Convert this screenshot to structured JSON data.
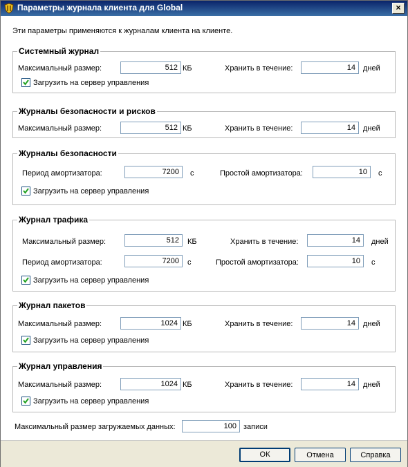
{
  "window": {
    "title": "Параметры журнала клиента для Global",
    "close_glyph": "×"
  },
  "intro_text": "Эти параметры применяются к журналам клиента на клиенте.",
  "groups": {
    "system": {
      "title": "Системный журнал",
      "max_size_label": "Максимальный размер:",
      "max_size_value": "512",
      "max_size_unit": "КБ",
      "keep_label": "Хранить в течение:",
      "keep_value": "14",
      "keep_unit": "дней",
      "upload_label": "Загрузить на сервер управления",
      "upload_checked": true
    },
    "security_risk": {
      "title": "Журналы безопасности и рисков",
      "max_size_label": "Максимальный размер:",
      "max_size_value": "512",
      "max_size_unit": "КБ",
      "keep_label": "Хранить в течение:",
      "keep_value": "14",
      "keep_unit": "дней"
    },
    "security": {
      "title": "Журналы безопасности",
      "damper_period_label": "Период амортизатора:",
      "damper_period_value": "7200",
      "damper_period_unit": "с",
      "damper_idle_label": "Простой амортизатора:",
      "damper_idle_value": "10",
      "damper_idle_unit": "с",
      "upload_label": "Загрузить на сервер управления",
      "upload_checked": true
    },
    "traffic": {
      "title": "Журнал трафика",
      "max_size_label": "Максимальный размер:",
      "max_size_value": "512",
      "max_size_unit": "КБ",
      "keep_label": "Хранить в течение:",
      "keep_value": "14",
      "keep_unit": "дней",
      "damper_period_label": "Период амортизатора:",
      "damper_period_value": "7200",
      "damper_period_unit": "с",
      "damper_idle_label": "Простой амортизатора:",
      "damper_idle_value": "10",
      "damper_idle_unit": "с",
      "upload_label": "Загрузить на сервер управления",
      "upload_checked": true
    },
    "packet": {
      "title": "Журнал пакетов",
      "max_size_label": "Максимальный размер:",
      "max_size_value": "1024",
      "max_size_unit": "КБ",
      "keep_label": "Хранить в течение:",
      "keep_value": "14",
      "keep_unit": "дней",
      "upload_label": "Загрузить на сервер управления",
      "upload_checked": true
    },
    "control": {
      "title": "Журнал управления",
      "max_size_label": "Максимальный размер:",
      "max_size_value": "1024",
      "max_size_unit": "КБ",
      "keep_label": "Хранить в течение:",
      "keep_value": "14",
      "keep_unit": "дней",
      "upload_label": "Загрузить на сервер управления",
      "upload_checked": true
    }
  },
  "upload_limit": {
    "label": "Максимальный размер загружаемых данных:",
    "value": "100",
    "unit": "записи"
  },
  "buttons": {
    "ok": "ОК",
    "cancel": "Отмена",
    "help": "Справка"
  }
}
